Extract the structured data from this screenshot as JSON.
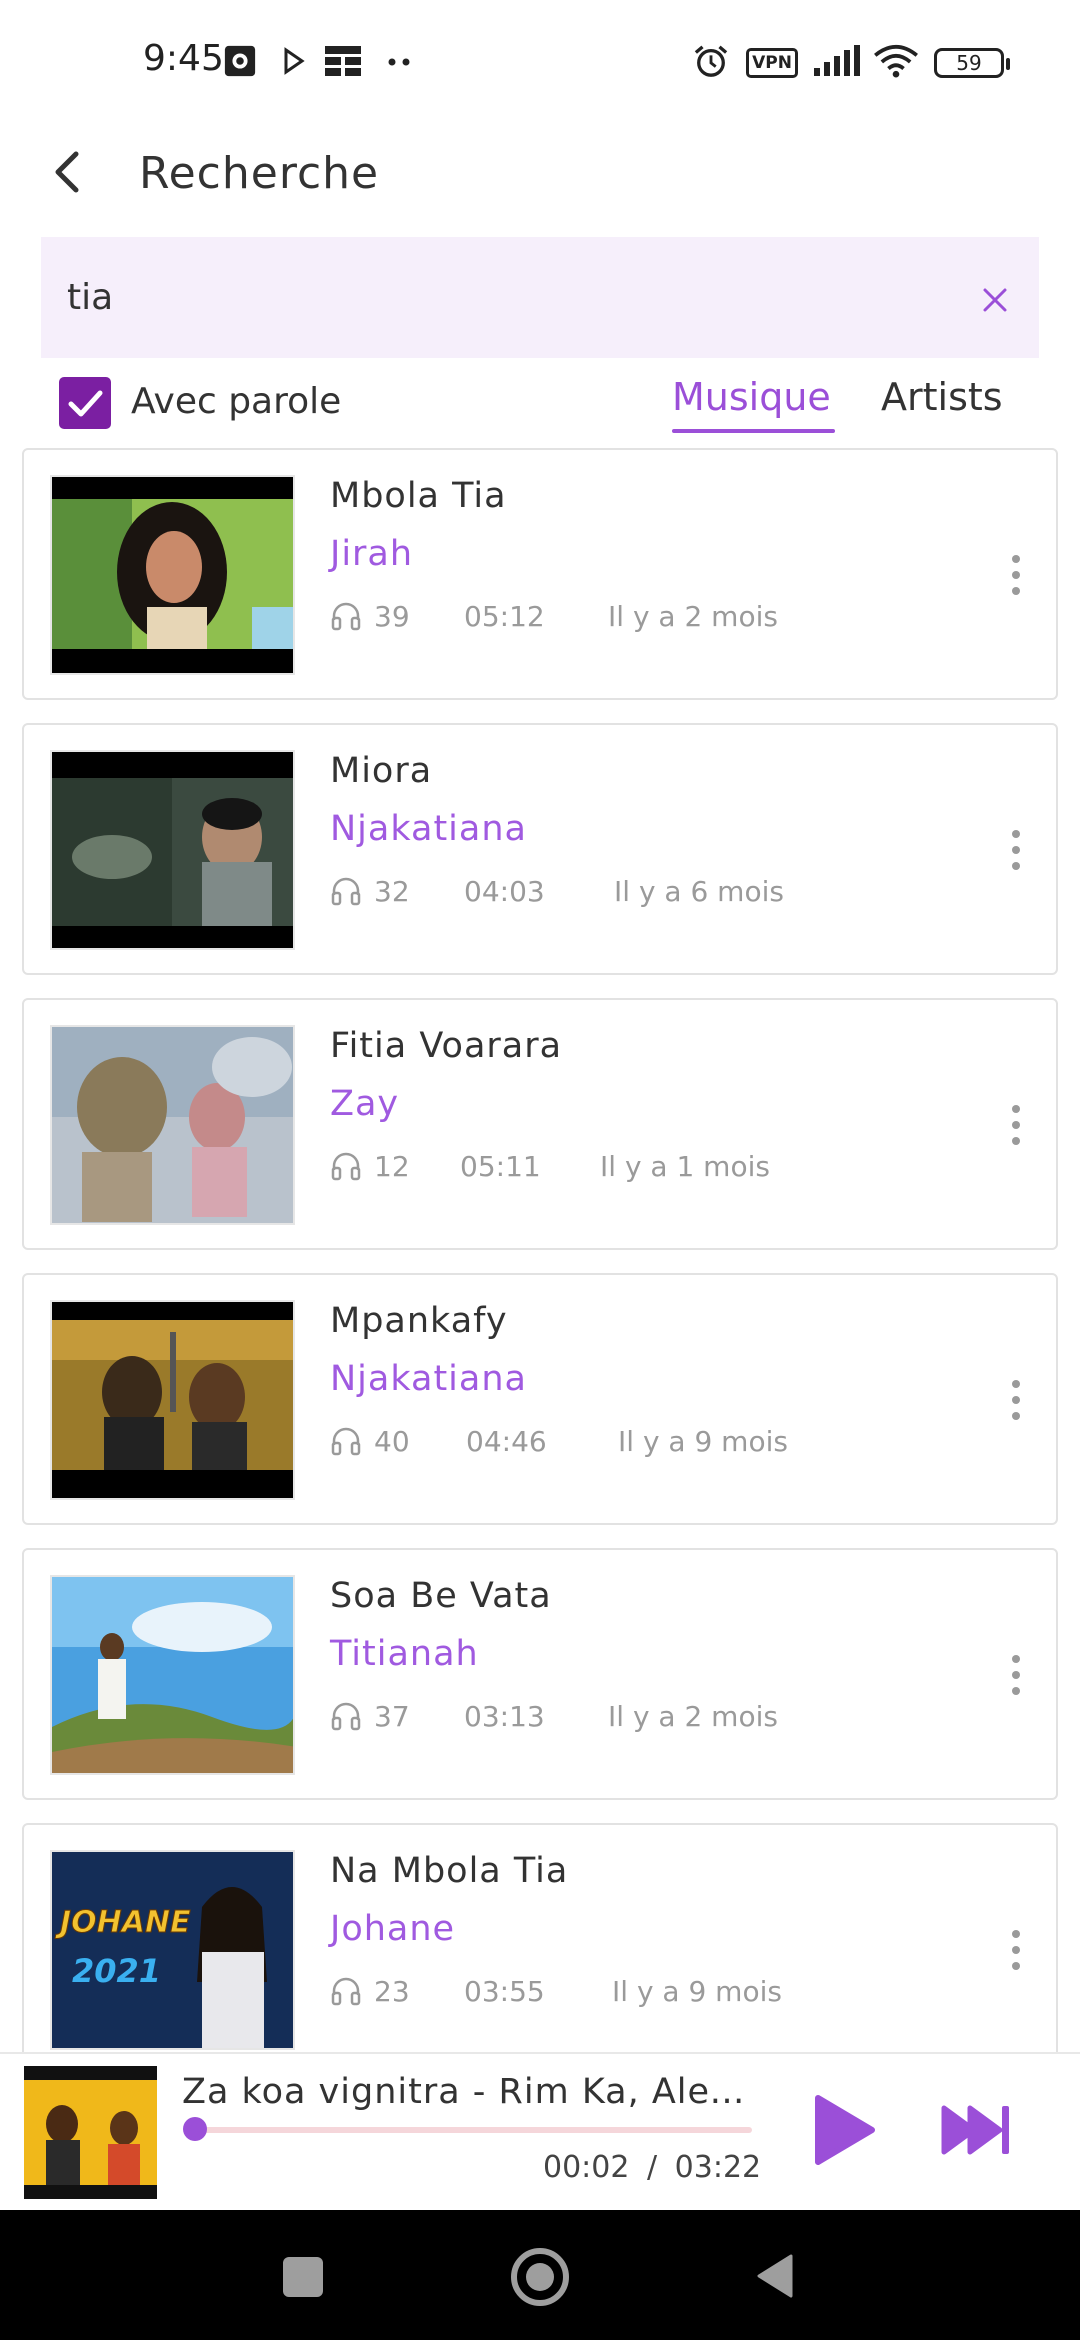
{
  "status_bar": {
    "time": "9:45",
    "vpn": "VPN",
    "battery": "59"
  },
  "header": {
    "title": "Recherche"
  },
  "search": {
    "value": "tia"
  },
  "filters": {
    "lyrics_label": "Avec parole",
    "lyrics_checked": true,
    "tabs": [
      {
        "label": "Musique",
        "active": true
      },
      {
        "label": "Artists",
        "active": false
      }
    ]
  },
  "songs": [
    {
      "title": "Mbola Tia",
      "artist": "Jirah",
      "plays": "39",
      "duration": "05:12",
      "age": "Il y a 2 mois"
    },
    {
      "title": "Miora",
      "artist": "Njakatiana",
      "plays": "32",
      "duration": "04:03",
      "age": "Il y a 6 mois"
    },
    {
      "title": "Fitia Voarara",
      "artist": "Zay",
      "plays": "12",
      "duration": "05:11",
      "age": "Il y a 1 mois"
    },
    {
      "title": "Mpankafy",
      "artist": "Njakatiana",
      "plays": "40",
      "duration": "04:46",
      "age": "Il y a 9 mois"
    },
    {
      "title": "Soa Be Vata",
      "artist": "Titianah",
      "plays": "37",
      "duration": "03:13",
      "age": "Il y a 2 mois"
    },
    {
      "title": "Na Mbola Tia",
      "artist": "Johane",
      "plays": "23",
      "duration": "03:55",
      "age": "Il y a 9 mois",
      "thumb_text": [
        "JOHANE",
        "2021"
      ]
    }
  ],
  "player": {
    "title": "Za koa vignitra - Rim Ka, Alex ...",
    "current": "00:02",
    "separator": "/",
    "total": "03:22",
    "progress": 0.01
  },
  "colors": {
    "accent": "#9b4fd8",
    "checkbox": "#7b1fa2",
    "search_bg": "#f6effb",
    "progress_track": "#f5d6da"
  }
}
